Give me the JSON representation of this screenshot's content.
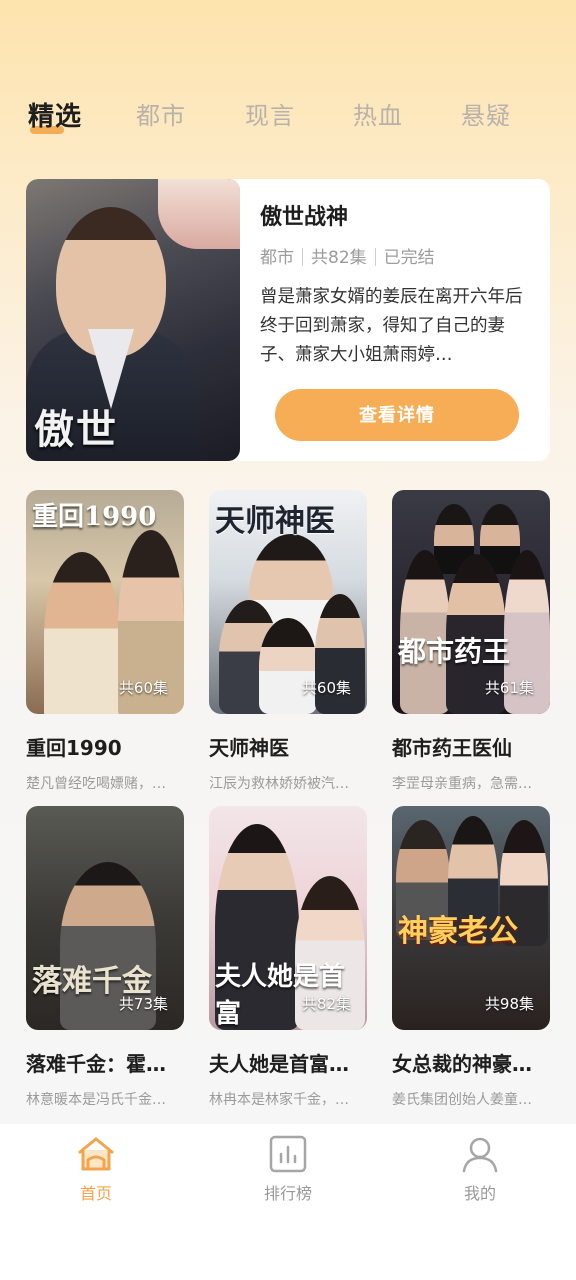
{
  "tabs": [
    {
      "label": "精选",
      "active": true
    },
    {
      "label": "都市",
      "active": false
    },
    {
      "label": "现言",
      "active": false
    },
    {
      "label": "热血",
      "active": false
    },
    {
      "label": "悬疑",
      "active": false
    }
  ],
  "featured": {
    "cover_text": "傲世",
    "title": "傲世战神",
    "genre": "都市",
    "episodes": "共82集",
    "status": "已完结",
    "description": "曾是萧家女婿的姜辰在离开六年后终于回到萧家，得知了自己的妻子、萧家大小姐萧雨婷…",
    "button_label": "查看详情"
  },
  "grid": [
    {
      "cover_text": "重回1990",
      "episodes": "共60集",
      "title": "重回1990",
      "desc": "楚凡曾经吃喝嫖赌，…"
    },
    {
      "cover_text": "天师神医",
      "episodes": "共60集",
      "title": "天师神医",
      "desc": "江辰为救林娇娇被汽…"
    },
    {
      "cover_text": "都市药王",
      "episodes": "共61集",
      "title": "都市药王医仙",
      "desc": "李罡母亲重病，急需…"
    },
    {
      "cover_text": "落难千金",
      "episodes": "共73集",
      "title": "落难千金：霍…",
      "desc": "林意暖本是冯氏千金…"
    },
    {
      "cover_text": "夫人她是首富",
      "episodes": "共82集",
      "title": "夫人她是首富…",
      "desc": "林冉本是林家千金，…"
    },
    {
      "cover_text": "神豪老公",
      "episodes": "共98集",
      "title": "女总裁的神豪…",
      "desc": "姜氏集团创始人姜童…"
    }
  ],
  "bottom_nav": [
    {
      "label": "首页",
      "icon": "home-icon",
      "active": true
    },
    {
      "label": "排行榜",
      "icon": "chart-icon",
      "active": false
    },
    {
      "label": "我的",
      "icon": "user-icon",
      "active": false
    }
  ],
  "colors": {
    "accent": "#f6ad55",
    "active_nav": "#f3a44d"
  }
}
